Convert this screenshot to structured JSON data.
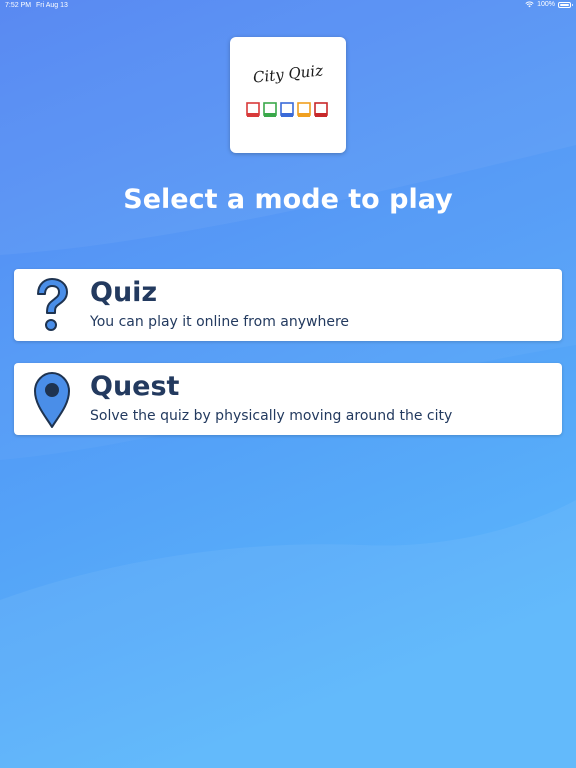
{
  "status_bar": {
    "time": "7:52 PM",
    "date": "Fri Aug 13",
    "battery": "100%",
    "icons": [
      "wifi-icon",
      "battery-icon"
    ]
  },
  "logo": {
    "text": "City Quiz",
    "frame_colors": [
      "#d83a3a",
      "#3aa84a",
      "#3a6ad8",
      "#f0a020",
      "#c8282a"
    ]
  },
  "title": "Select a mode to play",
  "modes": [
    {
      "title": "Quiz",
      "description": "You can play it online from anywhere",
      "icon": "question-mark-icon"
    },
    {
      "title": "Quest",
      "description": "Solve the quiz by physically moving around the city",
      "icon": "map-pin-icon"
    }
  ],
  "colors": {
    "background_top": "#4a7ff2",
    "background_bottom": "#5ab6fb",
    "card_text": "#233a5f",
    "icon_fill": "#4a8ee8",
    "icon_outline": "#1e3350"
  }
}
